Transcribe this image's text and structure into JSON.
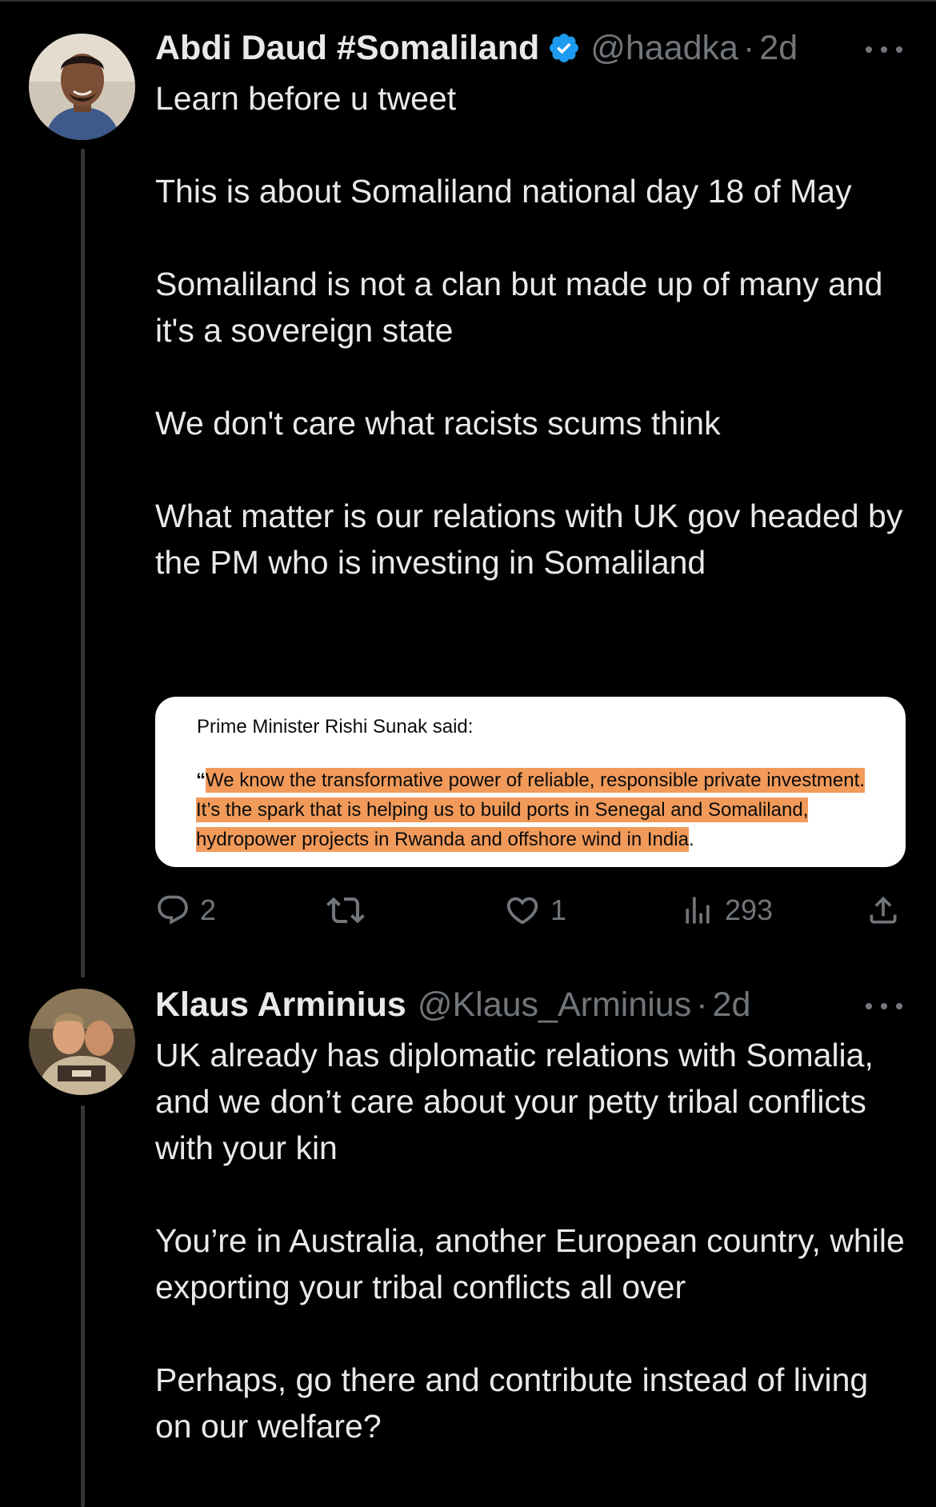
{
  "tweets": [
    {
      "display_name": "Abdi Daud #Somaliland",
      "verified": true,
      "handle": "@haadka",
      "separator": "·",
      "age": "2d",
      "paragraphs": [
        "Learn before u tweet",
        "This is about Somaliland national day 18 of May",
        "Somaliland is not a clan but made up of many and it's a sovereign state",
        "We don't care what racists scums think",
        "What matter is our relations with UK gov headed by the PM who is investing in Somaliland"
      ],
      "media": {
        "label": "Prime Minister Rishi Sunak said:",
        "open_quote": "“",
        "quote": "We know the transformative power of reliable, responsible private investment. It’s the spark that is helping us to build ports in Senegal and Somaliland, hydropower projects in Rwanda and offshore wind in India",
        "end": ".",
        "highlight_color": "#f19a5a"
      },
      "actions": {
        "reply_count": "2",
        "retweet_count": "",
        "like_count": "1",
        "views_count": "293"
      }
    },
    {
      "display_name": "Klaus Arminius",
      "verified": false,
      "handle": "@Klaus_Arminius",
      "separator": "·",
      "age": "2d",
      "paragraphs": [
        "UK already has diplomatic relations with Somalia, and we don’t care about your petty tribal conflicts with your kin",
        "You’re in Australia, another European country, while exporting your tribal conflicts all over",
        "Perhaps, go there and contribute instead of living on our welfare?"
      ]
    }
  ],
  "icons": {
    "verified": "verified-badge-icon",
    "more": "more-horizontal-icon",
    "reply": "reply-icon",
    "retweet": "retweet-icon",
    "like": "heart-icon",
    "views": "views-icon",
    "share": "share-icon"
  },
  "colors": {
    "background": "#000000",
    "text": "#e7e9ea",
    "muted": "#71767b",
    "verified_blue": "#1d9bf0",
    "thread_line": "#333639"
  }
}
